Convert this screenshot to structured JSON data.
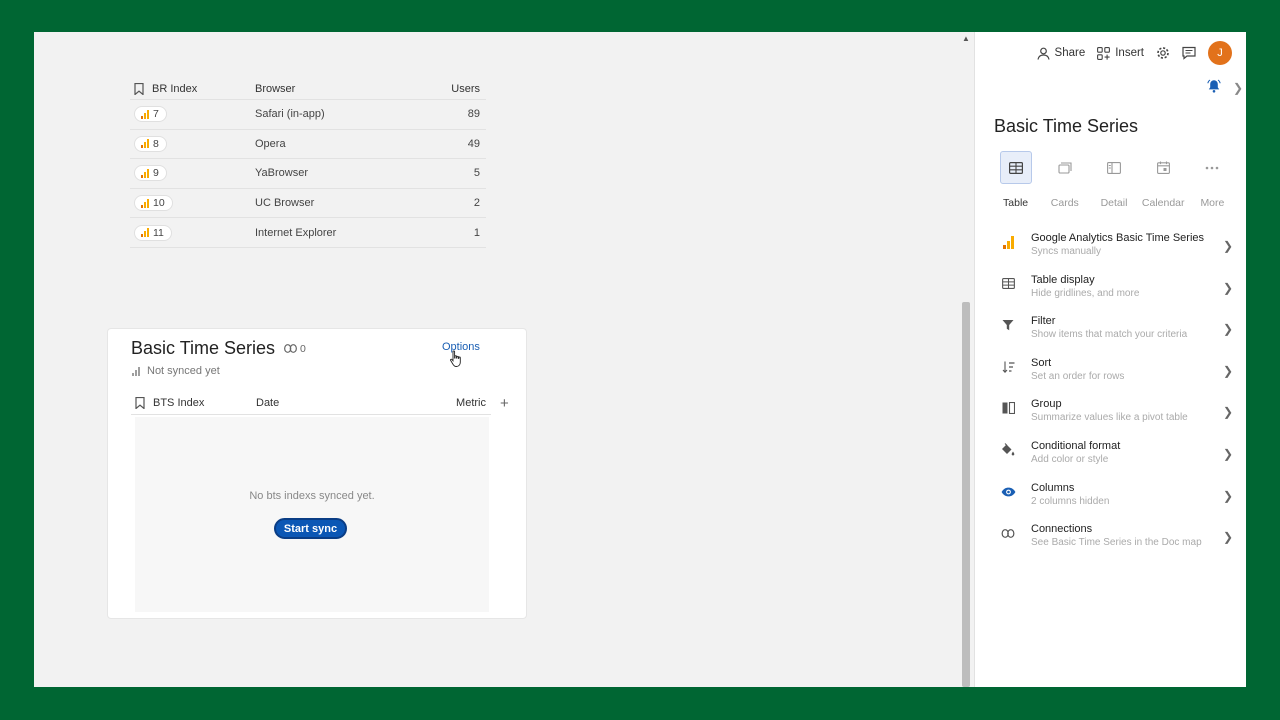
{
  "table1": {
    "headers": {
      "index": "BR Index",
      "browser": "Browser",
      "users": "Users"
    },
    "rows": [
      {
        "index": "7",
        "browser": "Safari (in-app)",
        "users": "89"
      },
      {
        "index": "8",
        "browser": "Opera",
        "users": "49"
      },
      {
        "index": "9",
        "browser": "YaBrowser",
        "users": "5"
      },
      {
        "index": "10",
        "browser": "UC Browser",
        "users": "2"
      },
      {
        "index": "11",
        "browser": "Internet Explorer",
        "users": "1"
      }
    ]
  },
  "card": {
    "title": "Basic Time Series",
    "link_count": "0",
    "status": "Not synced yet",
    "options_label": "Options",
    "headers": {
      "index": "BTS Index",
      "date": "Date",
      "metric": "Metric"
    },
    "add_column": "+",
    "empty_text": "No bts indexs synced yet.",
    "start_sync_label": "Start sync"
  },
  "topbar": {
    "share_label": "Share",
    "insert_label": "Insert",
    "avatar_initial": "J"
  },
  "panel": {
    "title": "Basic Time Series",
    "view_tabs": [
      {
        "label": "Table",
        "icon": "table-icon",
        "active": true
      },
      {
        "label": "Cards",
        "icon": "cards-icon",
        "active": false
      },
      {
        "label": "Detail",
        "icon": "detail-icon",
        "active": false
      },
      {
        "label": "Calendar",
        "icon": "calendar-icon",
        "active": false
      },
      {
        "label": "More",
        "icon": "more-icon",
        "active": false
      }
    ],
    "settings": [
      {
        "title": "Google Analytics Basic Time Series",
        "subtitle": "Syncs manually",
        "icon": "analytics-icon"
      },
      {
        "title": "Table display",
        "subtitle": "Hide gridlines, and more",
        "icon": "table-icon"
      },
      {
        "title": "Filter",
        "subtitle": "Show items that match your criteria",
        "icon": "filter-icon"
      },
      {
        "title": "Sort",
        "subtitle": "Set an order for rows",
        "icon": "sort-icon"
      },
      {
        "title": "Group",
        "subtitle": "Summarize values like a pivot table",
        "icon": "group-icon"
      },
      {
        "title": "Conditional format",
        "subtitle": "Add color or style",
        "icon": "paint-bucket-icon"
      },
      {
        "title": "Columns",
        "subtitle": "2 columns hidden",
        "icon": "eye-icon"
      },
      {
        "title": "Connections",
        "subtitle": "See Basic Time Series in the Doc map",
        "icon": "link-icon"
      }
    ]
  },
  "colors": {
    "background": "#006633",
    "accent": "#0b57b5",
    "analytics_orange": "#f9ab00",
    "avatar": "#e2721b"
  }
}
